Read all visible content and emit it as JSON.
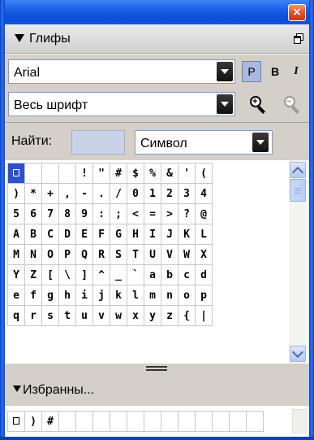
{
  "window": {
    "close_label": "×"
  },
  "panel": {
    "title": "Глифы"
  },
  "font": {
    "name": "Arial",
    "plain_label": "P",
    "bold_label": "B",
    "italic_label": "I"
  },
  "range": {
    "value": "Весь шрифт"
  },
  "search": {
    "label": "Найти:",
    "value": "",
    "type_value": "Символ"
  },
  "glyph_rows": [
    [
      "□",
      "",
      "",
      "",
      "!",
      "\"",
      "#",
      "$",
      "%",
      "&",
      "'",
      "("
    ],
    [
      ")",
      "*",
      "+",
      ",",
      "-",
      ".",
      "/",
      "0",
      "1",
      "2",
      "3",
      "4"
    ],
    [
      "5",
      "6",
      "7",
      "8",
      "9",
      ":",
      ";",
      "<",
      "=",
      ">",
      "?",
      "@"
    ],
    [
      "A",
      "B",
      "C",
      "D",
      "E",
      "F",
      "G",
      "H",
      "I",
      "J",
      "K",
      "L"
    ],
    [
      "M",
      "N",
      "O",
      "P",
      "Q",
      "R",
      "S",
      "T",
      "U",
      "V",
      "W",
      "X"
    ],
    [
      "Y",
      "Z",
      "[",
      "\\",
      "]",
      "^",
      "_",
      "`",
      "a",
      "b",
      "c",
      "d"
    ],
    [
      "e",
      "f",
      "g",
      "h",
      "i",
      "j",
      "k",
      "l",
      "m",
      "n",
      "o",
      "p"
    ],
    [
      "q",
      "r",
      "s",
      "t",
      "u",
      "v",
      "w",
      "x",
      "y",
      "z",
      "{",
      "|"
    ]
  ],
  "favorites": {
    "title": "Избранны...",
    "items": [
      "□",
      ")",
      "#",
      "",
      "",
      "",
      "",
      "",
      "",
      "",
      "",
      "",
      "",
      "",
      ""
    ]
  },
  "colors": {
    "selection": "#2a52c9",
    "titlebar": "#0d4fd8",
    "panel_bg": "#d4d0c8"
  }
}
